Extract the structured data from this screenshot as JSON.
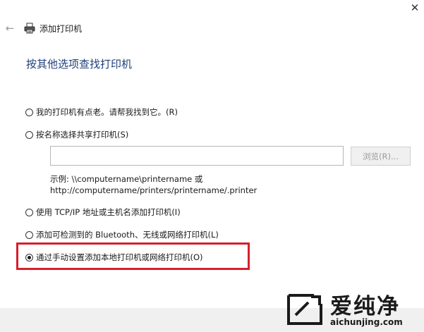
{
  "window": {
    "title": "添加打印机",
    "close_glyph": "✕",
    "back_glyph": "←"
  },
  "page": {
    "heading": "按其他选项查找打印机"
  },
  "options": [
    {
      "label": "我的打印机有点老。请帮我找到它。(R)",
      "checked": false
    },
    {
      "label": "按名称选择共享打印机(S)",
      "checked": false
    },
    {
      "label": "使用 TCP/IP 地址或主机名添加打印机(I)",
      "checked": false
    },
    {
      "label": "添加可检测到的 Bluetooth、无线或网络打印机(L)",
      "checked": false
    },
    {
      "label": "通过手动设置添加本地打印机或网络打印机(O)",
      "checked": true
    }
  ],
  "shared_printer": {
    "input_value": "",
    "browse_label": "浏览(R)...",
    "example_line1": "示例: \\\\computername\\printername 或",
    "example_line2": "http://computername/printers/printername/.printer"
  },
  "watermark": {
    "brand": "爱纯净",
    "url": "aichunjing.com"
  },
  "colors": {
    "heading": "#1e3f7a",
    "highlight": "#d6202d"
  }
}
